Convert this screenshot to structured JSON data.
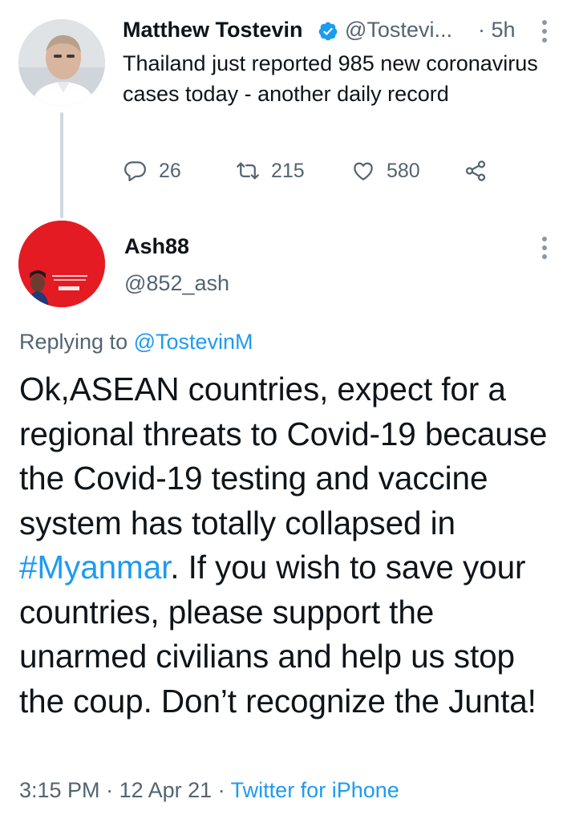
{
  "parent_tweet": {
    "author_name": "Matthew Tostevin",
    "handle": "@Tostevi...",
    "time": "· 5h",
    "text": "Thailand just reported 985 new coronavirus cases today - another daily record",
    "replies": "26",
    "retweets": "215",
    "likes": "580",
    "verified_color": "#1d9bf0"
  },
  "reply_tweet": {
    "author_name": "Ash88",
    "handle": "@852_ash",
    "replying_prefix": "Replying to ",
    "replying_to": "@TostevinM",
    "text_part1": "Ok,ASEAN countries, expect for a regional threats to Covid-19 because the Covid-19 testing and vaccine system has totally collapsed in ",
    "hashtag": "#Myanmar",
    "text_part2": ". If you wish to save your countries, please support the unarmed civilians and help us stop the coup. Don’t recognize the Junta!",
    "time": "3:15 PM",
    "date": "12 Apr 21",
    "source": "Twitter for iPhone",
    "separator": " · "
  },
  "icons": {
    "reply": "reply-icon",
    "retweet": "retweet-icon",
    "like": "like-icon",
    "share": "share-icon",
    "more": "more-options-icon",
    "verified": "verified-badge-icon"
  },
  "colors": {
    "link": "#1d9bf0",
    "secondary_text": "#536471",
    "avatar2_bg": "#e51b24"
  }
}
